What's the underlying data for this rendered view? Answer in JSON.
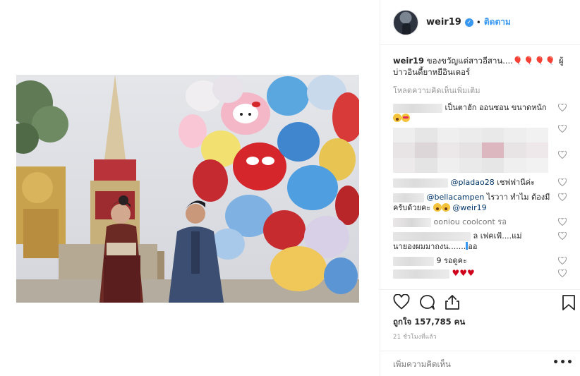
{
  "post": {
    "username": "weir19",
    "follow_label": "ติดตาม",
    "separator": "•",
    "caption_user": "weir19",
    "caption_text": "ของขวัญแด่สาวอีสาน....",
    "caption_emoji": "🎈🎈🎈🎈",
    "caption_text2": "ผู้บ่าวอินดี้ยาหยีอินเดอร์",
    "load_more": "โหลดความคิดเห็นเพิ่มเติม"
  },
  "comments": [
    {
      "text": "เป็นตาฮัก ออนซอน ขนาดหนัก"
    },
    {
      "mention": "@pladao28",
      "text": "เชฟฟานีค่ะ"
    },
    {
      "mention": "@bellacampen",
      "text": "ไรวาา ทำไม ต้องมีครับด้วยคะ",
      "mention2": "@weir19"
    },
    {
      "text": "ooniou coolcont รอ"
    },
    {
      "text": "ล เฟคเฟ้....แม่"
    },
    {
      "text": "นายองผมมาถงน.......",
      "tail": "ออ"
    },
    {
      "text": "9 รอดูคะ"
    },
    {
      "hearts": "♥♥♥"
    }
  ],
  "actions": {
    "likes": "ถูกใจ 157,785 คน",
    "time": "21 ชั่วโมงที่แล้ว",
    "add_comment_placeholder": "เพิ่มความคิดเห็น",
    "more": "•••"
  },
  "icons": {
    "like": "heart-outline-icon",
    "comment": "comment-bubble-icon",
    "share": "share-upload-icon",
    "save": "bookmark-icon",
    "verified": "verified-badge-icon"
  },
  "colors": {
    "accent": "#3897f0",
    "text": "#262626",
    "muted": "#999999",
    "border": "#efefef",
    "heart_red": "#d0021b"
  }
}
